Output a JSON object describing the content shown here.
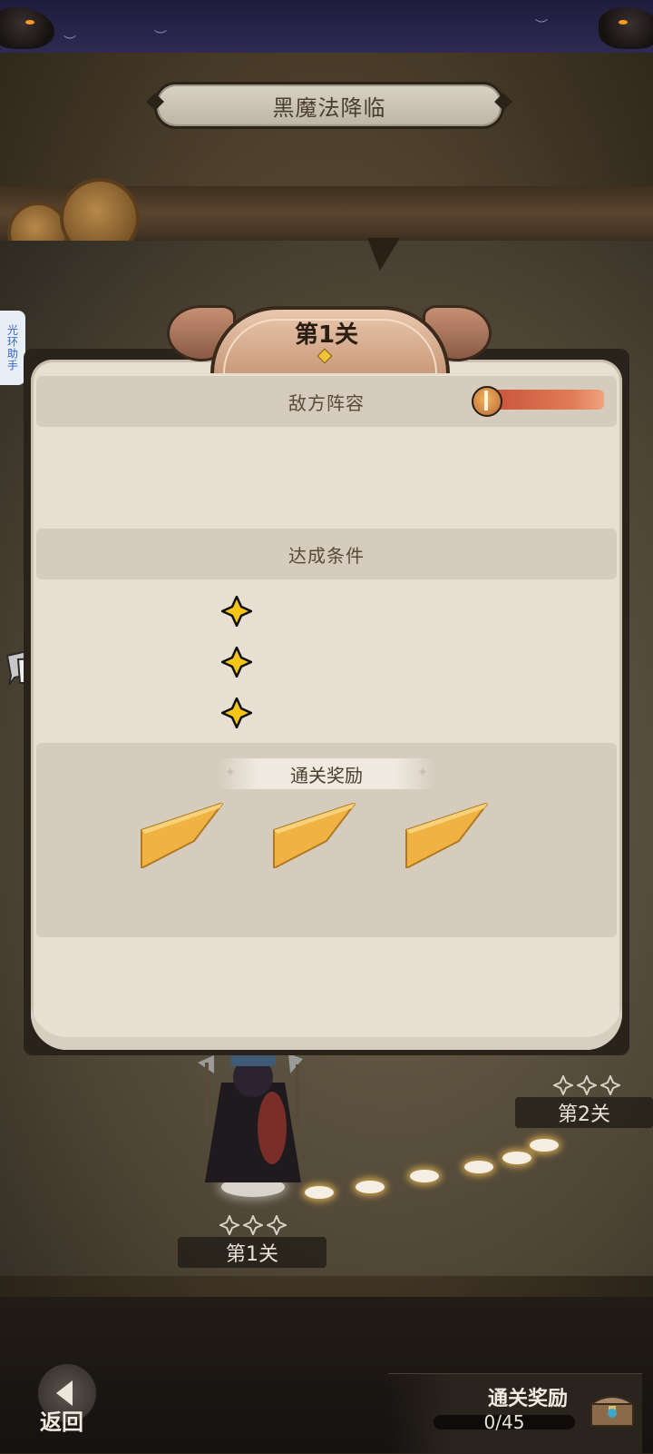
{
  "event_title": "黑魔法降临",
  "assistant_tab": "光环助手",
  "stage_panel": {
    "title": "第1关",
    "enemy_section_label": "敌方阵容",
    "conditions_section_label": "达成条件",
    "condition_count": 3,
    "rewards_label": "通关奖励",
    "reward_slots": 3
  },
  "map": {
    "stage1_label": "第1关",
    "stage2_label": "第2关",
    "stage1_stars": 3,
    "stage2_stars": 3
  },
  "bottom": {
    "back_label": "返回",
    "clear_reward_title": "通关奖励",
    "clear_reward_progress": "0/45"
  },
  "colors": {
    "gold_star": "#f5c518",
    "power_bar": "#c9543a",
    "panel_bg": "#e6dfd2"
  }
}
